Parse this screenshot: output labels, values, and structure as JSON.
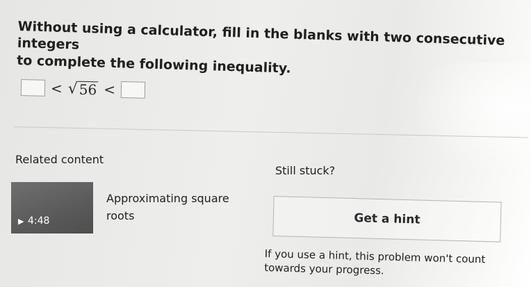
{
  "question": {
    "line1": "Without using a calculator, fill in the blanks with two consecutive integers",
    "line2": "to complete the following inequality."
  },
  "inequality": {
    "less_than": "<",
    "radicand": "56"
  },
  "related": {
    "heading": "Related content",
    "video": {
      "duration": "4:48",
      "title": "Approximating square roots"
    }
  },
  "help": {
    "stuck": "Still stuck?",
    "hint_button": "Get a hint",
    "note": "If you use a hint, this problem won't count towards your progress."
  }
}
